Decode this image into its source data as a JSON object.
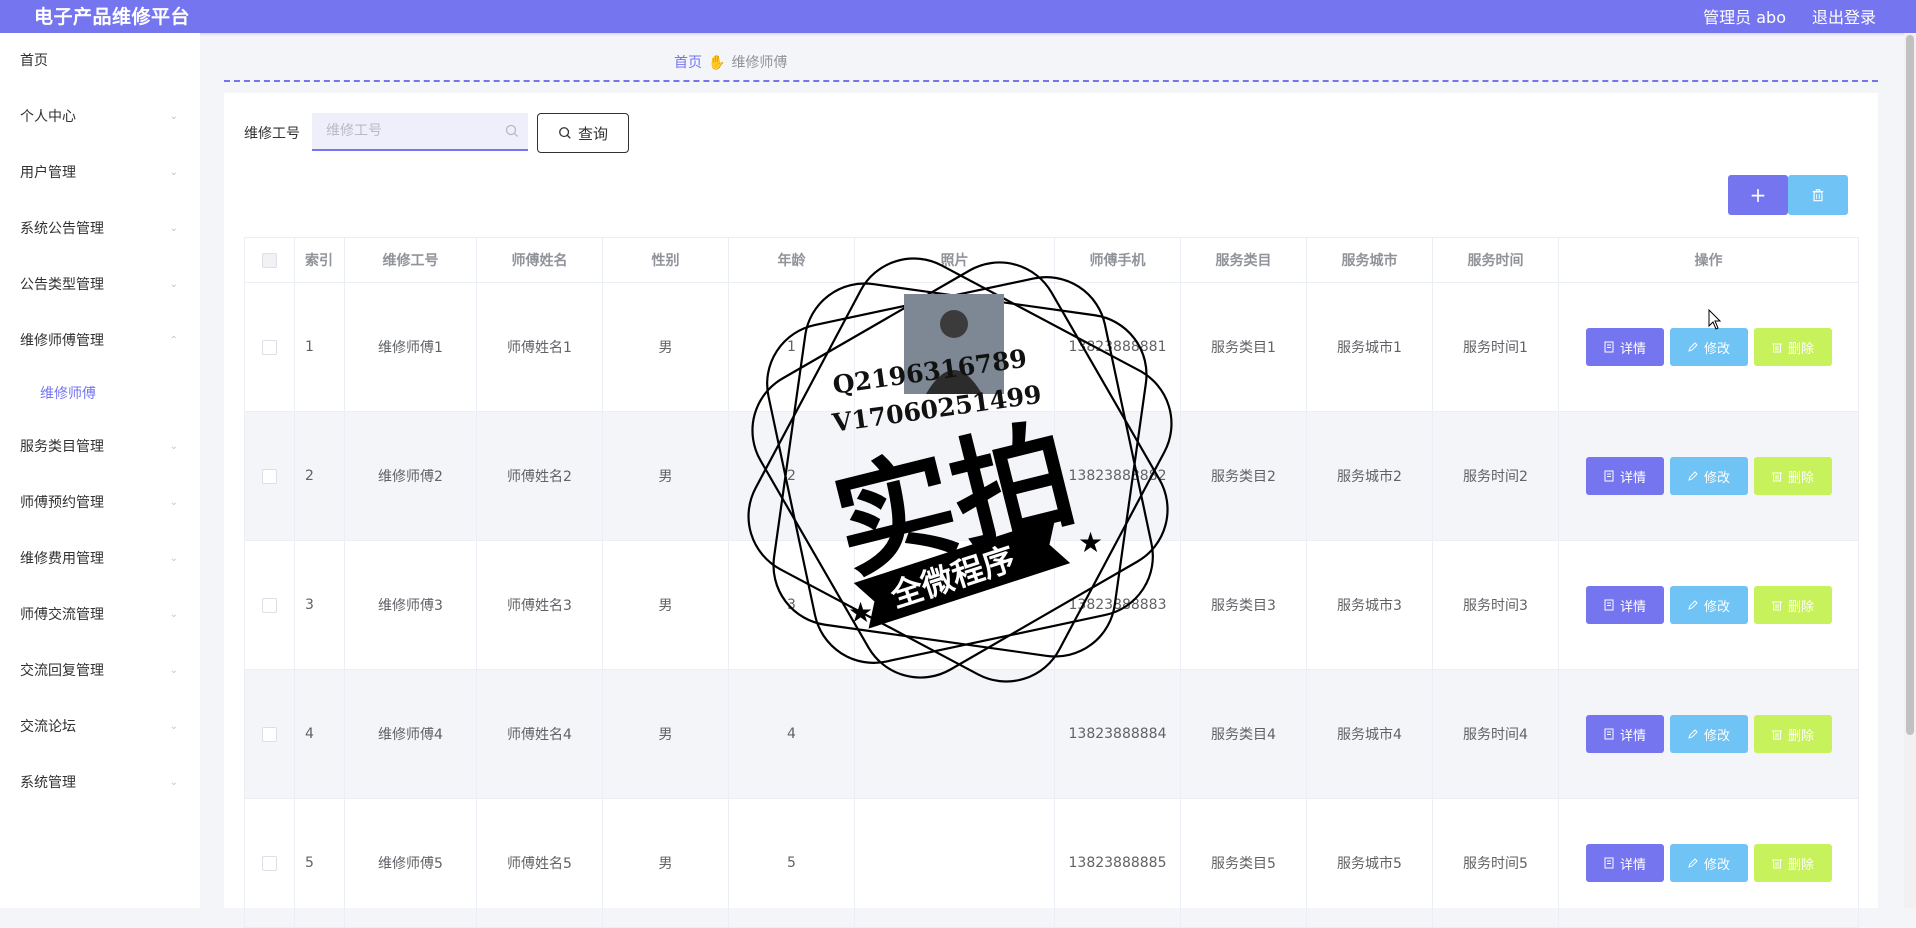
{
  "header": {
    "title": "电子产品维修平台",
    "user": "管理员 abo",
    "logout": "退出登录"
  },
  "sidebar": {
    "items": [
      {
        "label": "首页",
        "chevron": ""
      },
      {
        "label": "个人中心",
        "chevron": "⌄"
      },
      {
        "label": "用户管理",
        "chevron": "⌄"
      },
      {
        "label": "系统公告管理",
        "chevron": "⌄"
      },
      {
        "label": "公告类型管理",
        "chevron": "⌄"
      },
      {
        "label": "维修师傅管理",
        "chevron": "⌃"
      },
      {
        "label": "服务类目管理",
        "chevron": "⌄"
      },
      {
        "label": "师傅预约管理",
        "chevron": "⌄"
      },
      {
        "label": "维修费用管理",
        "chevron": "⌄"
      },
      {
        "label": "师傅交流管理",
        "chevron": "⌄"
      },
      {
        "label": "交流回复管理",
        "chevron": "⌄"
      },
      {
        "label": "交流论坛",
        "chevron": "⌄"
      },
      {
        "label": "系统管理",
        "chevron": "⌄"
      }
    ],
    "sub_item": "维修师傅"
  },
  "breadcrumb": {
    "home": "首页",
    "current": "维修师傅"
  },
  "search": {
    "label": "维修工号",
    "placeholder": "维修工号",
    "button": "查询"
  },
  "toolbar": {
    "add": "+"
  },
  "table": {
    "headers": [
      "索引",
      "维修工号",
      "师傅姓名",
      "性别",
      "年龄",
      "照片",
      "师傅手机",
      "服务类目",
      "服务城市",
      "服务时间",
      "操作"
    ],
    "rows": [
      {
        "index": "1",
        "worker_no": "维修师傅1",
        "name": "师傅姓名1",
        "gender": "男",
        "age": "1",
        "phone": "13823888881",
        "category": "服务类目1",
        "city": "服务城市1",
        "time": "服务时间1"
      },
      {
        "index": "2",
        "worker_no": "维修师傅2",
        "name": "师傅姓名2",
        "gender": "男",
        "age": "2",
        "phone": "13823888882",
        "category": "服务类目2",
        "city": "服务城市2",
        "time": "服务时间2"
      },
      {
        "index": "3",
        "worker_no": "维修师傅3",
        "name": "师傅姓名3",
        "gender": "男",
        "age": "3",
        "phone": "13823888883",
        "category": "服务类目3",
        "city": "服务城市3",
        "time": "服务时间3"
      },
      {
        "index": "4",
        "worker_no": "维修师傅4",
        "name": "师傅姓名4",
        "gender": "男",
        "age": "4",
        "phone": "13823888884",
        "category": "服务类目4",
        "city": "服务城市4",
        "time": "服务时间4"
      },
      {
        "index": "5",
        "worker_no": "维修师傅5",
        "name": "师傅姓名5",
        "gender": "男",
        "age": "5",
        "phone": "13823888885",
        "category": "服务类目5",
        "city": "服务城市5",
        "time": "服务时间5"
      }
    ],
    "actions": {
      "detail": "详情",
      "edit": "修改",
      "delete": "删除"
    }
  },
  "watermark": {
    "line1": "Q2196316789",
    "line2": "V17060251499",
    "main": "实拍",
    "banner": "全微程序"
  },
  "colors": {
    "primary": "#7575f0",
    "info": "#6fc3f5",
    "danger": "#c8f25b"
  }
}
